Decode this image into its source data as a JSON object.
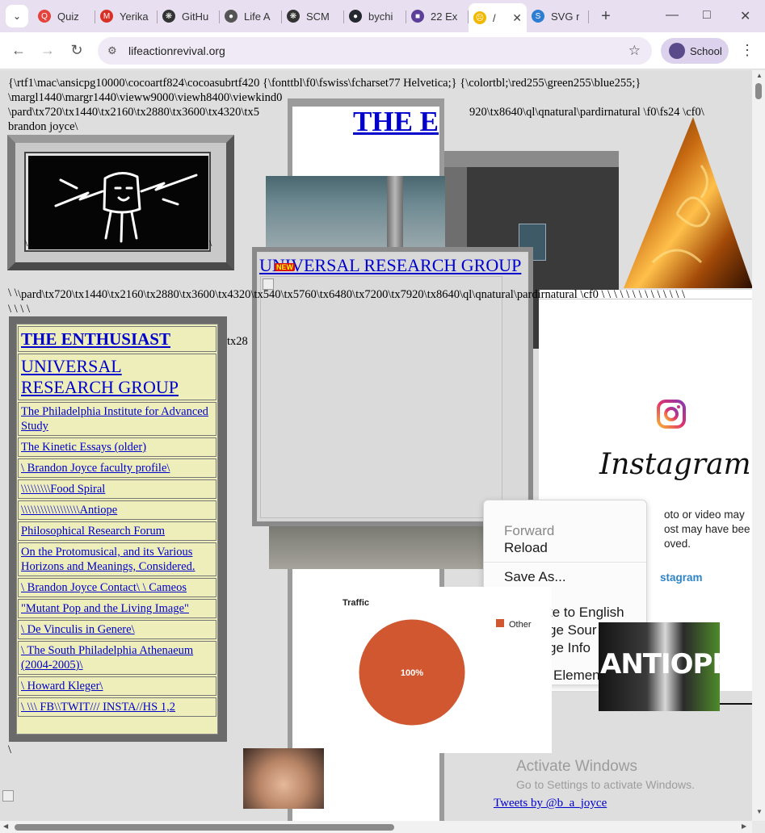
{
  "browser": {
    "tabs": [
      {
        "label": "Quiz",
        "icon": "quizlet-icon",
        "color": "#e4423a"
      },
      {
        "label": "Yerika",
        "icon": "gmail-icon",
        "color": "#d93025"
      },
      {
        "label": "GitHu",
        "icon": "chatgpt-icon",
        "color": "#333333"
      },
      {
        "label": "Life A",
        "icon": "globe-icon",
        "color": "#555555"
      },
      {
        "label": "SCM",
        "icon": "chatgpt-icon",
        "color": "#333333"
      },
      {
        "label": "bychi",
        "icon": "github-icon",
        "color": "#24292f"
      },
      {
        "label": "22 Ex",
        "icon": "coolors-icon",
        "color": "#5b3f9a"
      },
      {
        "label": "/",
        "icon": "sad-face-icon",
        "color": "#f2b800"
      },
      {
        "label": "SVG r",
        "icon": "svg-site-icon",
        "color": "#2d7dd2"
      }
    ],
    "active_tab_index": 7,
    "url": "lifeactionrevival.org",
    "profile_label": "School"
  },
  "page": {
    "rtf_lines": [
      "{\\rtf1\\mac\\ansicpg10000\\cocoartf824\\cocoasubrtf420 {\\fonttbl\\f0\\fswiss\\fcharset77 Helvetica;} {\\colortbl;\\red255\\green255\\blue255;}",
      "\\margl1440\\margr1440\\vieww9000\\viewh8400\\viewkind0",
      "\\pard\\tx720\\tx1440\\tx2160\\tx2880\\tx3600\\tx4320\\tx5",
      "920\\tx8640\\ql\\qnatural\\pardirnatural \\f0\\fs24 \\cf0\\",
      "brandon joyce\\"
    ],
    "mid_rtf": "\\pard\\tx720\\tx1440\\tx2160\\tx2880\\tx3600\\tx4320\\tx540\\tx5760\\tx6480\\tx7200\\tx7920\\tx8640\\ql\\qnatural\\pardirnatural \\cf0 \\ \\ \\ \\ \\ \\ \\ \\ \\ \\ \\ \\ \\ \\",
    "slashes_a": "\\ \\",
    "slashes_b": "\\ \\ \\ \\",
    "tx28": "tx28",
    "enthusiast_partial": "THE E",
    "urg_title": "UNIVERSAL RESEARCH GROUP",
    "new_badge": "NEW",
    "nav_links": [
      "THE ENTHUSIAST",
      "UNIVERSAL RESEARCH GROUP",
      "The Philadelphia Institute for Advanced Study",
      "The Kinetic Essays (older)",
      "\\ Brandon Joyce faculty profile\\",
      "\\\\\\\\\\\\\\\\\\Food Spiral",
      "\\\\\\\\\\\\\\\\\\\\\\\\\\\\\\\\\\\\Antiope",
      "Philosophical Research Forum",
      "On the Protomusical, and its Various Horizons and Meanings, Considered.",
      "\\ Brandon Joyce Contact\\ \\ Cameos",
      "\"Mutant Pop and the Living Image\"",
      "\\ De Vinculis in Genere\\",
      "\\ The South Philadelphia Athenaeum (2004-2005)\\",
      "\\ Howard Kleger\\",
      "\\ \\\\\\ FB\\\\TWIT/// INSTA//HS 1,2"
    ],
    "instagram": {
      "wordmark": "Instagram",
      "notice_lines": [
        "oto or video may",
        "ost may have bee",
        "oved."
      ],
      "link": "stagram"
    },
    "context_menu": [
      "Forward",
      "Reload",
      "Save As...",
      "te to English",
      "ge Sour",
      "ge Info",
      "Elemen"
    ],
    "chart_data": {
      "type": "pie",
      "title": "Traffic",
      "categories": [
        "Other"
      ],
      "values": [
        100
      ],
      "colors": [
        "#d0572f"
      ],
      "data_label": "100%",
      "legend": "top-right"
    },
    "antiope_label": "ANTIOPE",
    "watermark_title": "Activate Windows",
    "watermark_sub": "Go to Settings to activate Windows.",
    "tweets_link": "Tweets by @b_a_joyce",
    "trailing_slash": "\\"
  }
}
